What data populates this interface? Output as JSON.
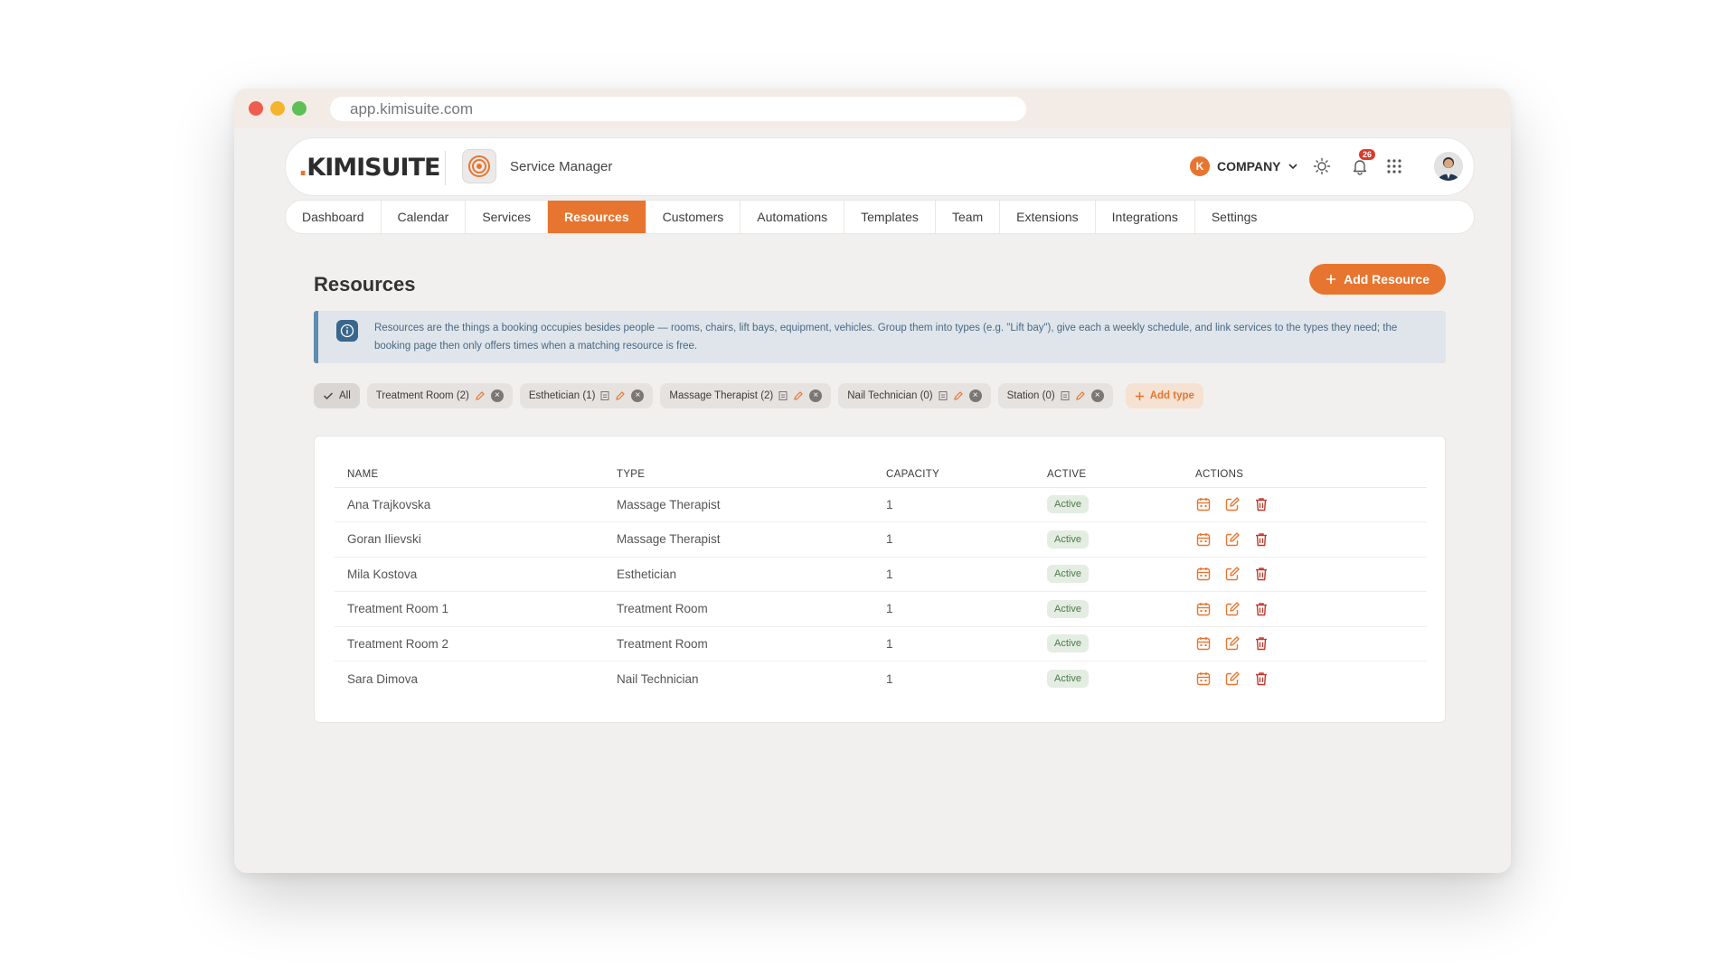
{
  "browser": {
    "url": "app.kimisuite.com"
  },
  "header": {
    "logo_dot": ".",
    "logo_text": "KIMISUITE",
    "app_name": "Service Manager",
    "company_initial": "K",
    "company_name": "COMPANY",
    "notification_count": "26"
  },
  "nav": {
    "items": [
      "Dashboard",
      "Calendar",
      "Services",
      "Resources",
      "Customers",
      "Automations",
      "Templates",
      "Team",
      "Extensions",
      "Integrations",
      "Settings"
    ],
    "active": "Resources"
  },
  "page": {
    "title": "Resources",
    "add_button": "Add Resource",
    "info_text": "Resources are the things a booking occupies besides people — rooms, chairs, lift bays, equipment, vehicles. Group them into types (e.g. \"Lift bay\"), give each a weekly schedule, and link services to the types they need; the booking page then only offers times when a matching resource is free."
  },
  "filters": {
    "all_label": "All",
    "chips": [
      "Treatment Room (2)",
      "Esthetician (1)",
      "Massage Therapist (2)",
      "Nail Technician (0)",
      "Station (0)"
    ],
    "add_type_label": "Add type"
  },
  "table": {
    "headers": {
      "name": "NAME",
      "type": "TYPE",
      "capacity": "CAPACITY",
      "active": "ACTIVE",
      "actions": "ACTIONS"
    },
    "rows": [
      {
        "name": "Ana Trajkovska",
        "type": "Massage Therapist",
        "capacity": "1",
        "status": "Active"
      },
      {
        "name": "Goran Ilievski",
        "type": "Massage Therapist",
        "capacity": "1",
        "status": "Active"
      },
      {
        "name": "Mila Kostova",
        "type": "Esthetician",
        "capacity": "1",
        "status": "Active"
      },
      {
        "name": "Treatment Room 1",
        "type": "Treatment Room",
        "capacity": "1",
        "status": "Active"
      },
      {
        "name": "Treatment Room 2",
        "type": "Treatment Room",
        "capacity": "1",
        "status": "Active"
      },
      {
        "name": "Sara Dimova",
        "type": "Nail Technician",
        "capacity": "1",
        "status": "Active"
      }
    ]
  },
  "colors": {
    "accent": "#e8752f",
    "info_bg": "#dfe5ea",
    "info_text": "#4a6885",
    "status_bg": "#e3ede2",
    "status_text": "#4e7a4c",
    "danger": "#c0392b"
  }
}
